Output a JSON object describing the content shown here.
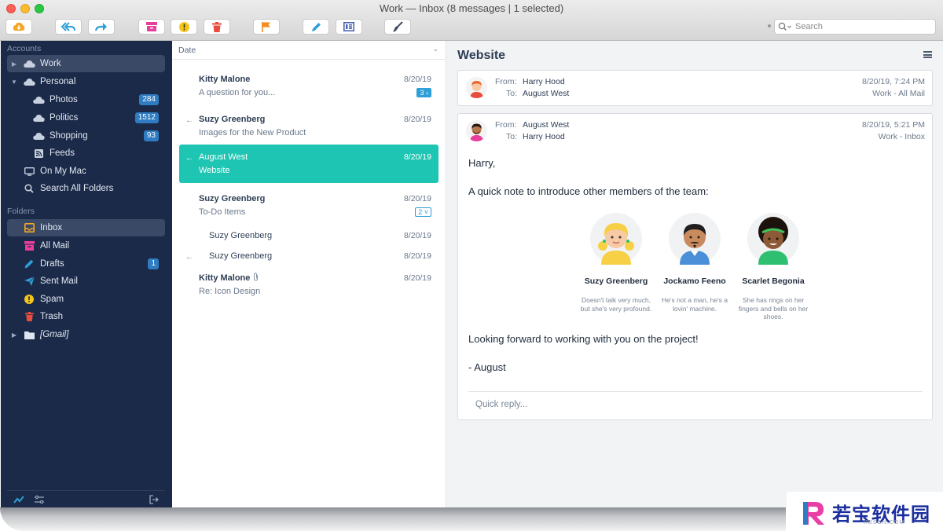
{
  "window": {
    "title": "Work — Inbox (8 messages | 1 selected)"
  },
  "toolbar": {
    "icons": [
      "download-icon",
      "reply-all-icon",
      "forward-icon",
      "archive-icon",
      "spam-icon",
      "trash-icon",
      "flag-icon",
      "compose-icon",
      "template-icon",
      "brush-icon"
    ],
    "search_placeholder": "Search"
  },
  "sidebar": {
    "accounts_heading": "Accounts",
    "accounts": [
      {
        "label": "Work",
        "icon": "cloud-icon",
        "selected": true
      },
      {
        "label": "Personal",
        "icon": "cloud-icon"
      },
      {
        "label": "Photos",
        "icon": "cloud-icon",
        "badge": "284"
      },
      {
        "label": "Politics",
        "icon": "cloud-icon",
        "badge": "1512"
      },
      {
        "label": "Shopping",
        "icon": "cloud-icon",
        "badge": "93"
      },
      {
        "label": "Feeds",
        "icon": "rss-icon"
      },
      {
        "label": "On My Mac",
        "icon": "computer-icon"
      },
      {
        "label": "Search All Folders",
        "icon": "search-icon"
      }
    ],
    "folders_heading": "Folders",
    "folders": [
      {
        "label": "Inbox",
        "icon": "inbox-icon",
        "color": "#f5a623",
        "selected": true
      },
      {
        "label": "All Mail",
        "icon": "archive-icon",
        "color": "#e83e9c"
      },
      {
        "label": "Drafts",
        "icon": "pencil-icon",
        "color": "#2f9fd8",
        "badge": "1"
      },
      {
        "label": "Sent Mail",
        "icon": "paper-plane-icon",
        "color": "#2f9fd8"
      },
      {
        "label": "Spam",
        "icon": "exclamation-icon",
        "color": "#f5c518"
      },
      {
        "label": "Trash",
        "icon": "trash-icon",
        "color": "#e84c3d"
      },
      {
        "label": "[Gmail]",
        "icon": "folder-icon",
        "color": "#dfe6f2"
      }
    ]
  },
  "message_list": {
    "sort_label": "Date",
    "messages": [
      {
        "sender": "Kitty Malone",
        "subject": "A question for you...",
        "date": "8/20/19",
        "thread_count": "3 ›"
      },
      {
        "sender": "Suzy Greenberg",
        "subject": "Images for the New Product",
        "date": "8/20/19",
        "reply_mark": "←"
      },
      {
        "sender": "August West",
        "subject": "Website",
        "date": "8/20/19",
        "reply_mark": "←",
        "selected": true
      },
      {
        "sender": "Suzy Greenberg",
        "subject": "To-Do Items",
        "date": "8/20/19",
        "thread_count": "2 ˅"
      },
      {
        "sender": "Suzy Greenberg",
        "subject": "",
        "date": "8/20/19"
      },
      {
        "sender": "Suzy Greenberg",
        "subject": "",
        "date": "8/20/19",
        "reply_mark": "←"
      },
      {
        "sender": "Kitty Malone",
        "subject": "Re: Icon Design",
        "date": "8/20/19",
        "attachment_icon": "paperclip-icon"
      }
    ]
  },
  "reader": {
    "title": "Website",
    "emails": [
      {
        "from_label": "From:",
        "from": "Harry Hood",
        "to_label": "To:",
        "to": "August West",
        "datetime": "8/20/19, 7:24 PM",
        "location": "Work - All Mail"
      },
      {
        "from_label": "From:",
        "from": "August West",
        "to_label": "To:",
        "to": "Harry Hood",
        "datetime": "8/20/19, 5:21 PM",
        "location": "Work - Inbox",
        "greeting": "Harry,",
        "intro": "A quick note to introduce other members of the team:",
        "people": [
          {
            "name": "Suzy Greenberg",
            "desc": "Doesn't talk very much, but she's very profound."
          },
          {
            "name": "Jockamo Feeno",
            "desc": "He's not a man, he's a lovin' machine."
          },
          {
            "name": "Scarlet Begonia",
            "desc": "She has rings on her fingers and bells on her shoes."
          }
        ],
        "closing": "Looking forward to working with you on the project!",
        "signature": "- August"
      }
    ],
    "quick_reply_placeholder": "Quick reply..."
  },
  "watermark": {
    "text": "若宝软件园",
    "sub": "RBSON.COM"
  }
}
